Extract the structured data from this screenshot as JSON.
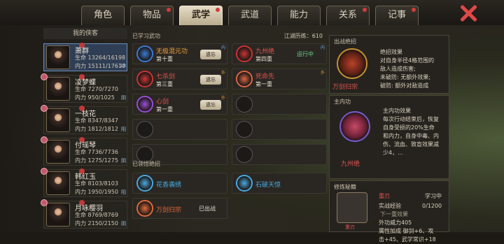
{
  "tabs": [
    {
      "label": "角色",
      "dot": false
    },
    {
      "label": "物品",
      "dot": true
    },
    {
      "label": "武学",
      "dot": true,
      "active": true
    },
    {
      "label": "武道",
      "dot": false
    },
    {
      "label": "能力",
      "dot": false
    },
    {
      "label": "关系",
      "dot": true
    },
    {
      "label": "记事",
      "dot": true
    }
  ],
  "left": {
    "header": "我的侠客",
    "heroes": [
      {
        "name": "萧群",
        "hp": "生命 13264/16198",
        "mp": "内力 15111/17610",
        "lv": "18",
        "selected": true
      },
      {
        "name": "凌梦蝶",
        "hp": "生命 7270/7270",
        "mp": "内力 950/1025",
        "lv": "阴"
      },
      {
        "name": "一枝花",
        "hp": "生命 8347/8347",
        "mp": "内力 1812/1812",
        "lv": "阳"
      },
      {
        "name": "付瑶琴",
        "hp": "生命 7736/7736",
        "mp": "内力 1275/1275",
        "lv": "阴"
      },
      {
        "name": "韩红玉",
        "hp": "生命 8103/8103",
        "mp": "内力 1950/1950",
        "lv": "阳"
      },
      {
        "name": "月咏樱羽",
        "hp": "生命 8769/8769",
        "mp": "内力 2150/2150",
        "lv": "阴"
      }
    ]
  },
  "mid": {
    "learned_title": "已学习武功",
    "points": "江湖历练：610",
    "skills": [
      {
        "name": "无极混元功",
        "level": "第十重",
        "color": "#f0a23a",
        "tag": "内",
        "tagType": "t",
        "btn": "遗忘",
        "iconColor": "#3a7bd5"
      },
      {
        "name": "九州绝",
        "level": "第四重",
        "color": "#e0534e",
        "tag": "内",
        "tagType": "t",
        "status": "运行中",
        "iconColor": "#c33"
      },
      {
        "name": "七杀剑",
        "level": "第三重",
        "color": "#e0534e",
        "tag": "外",
        "tagType": "w",
        "btn": "遗忘",
        "iconColor": "#c33"
      },
      {
        "name": "死命先",
        "level": "第一重",
        "color": "#e0534e",
        "tag": "外",
        "tagType": "w",
        "iconColor": "#d64"
      },
      {
        "name": "心剑",
        "level": "第一重",
        "color": "#e0534e",
        "tag": "外",
        "tagType": "w",
        "btn": "遗忘",
        "iconColor": "#9c4dd6"
      }
    ],
    "ult_title": "已领悟绝招",
    "ults": [
      {
        "name": "花香袭绣",
        "color": "#4aa9e0"
      },
      {
        "name": "石破天惊",
        "color": "#4aa9e0"
      },
      {
        "name": "万剑归宗",
        "color": "#e06a3a",
        "status": "已出战"
      }
    ]
  },
  "right": {
    "ult_panel": "出战绝招",
    "ult_name": "万剑归宗",
    "ult_effect_title": "绝招效果",
    "ult_effect": [
      "对自身半径4格范围的",
      "敌人造成伤害;",
      "未破防: 无额外效果;",
      "破防: 额外对敌造成"
    ],
    "inner_panel": "主内功",
    "inner_name": "九州绝",
    "inner_effect_title": "主内功效果",
    "inner_effect": [
      "每次行动结束后，恢复",
      "自身受损的20%生命",
      "和内力，自身中毒、内",
      "伤、流血、致盲效果减",
      "少4，..."
    ],
    "train_panel": "修炼秘籍",
    "train_name": "重刃",
    "train_state": "学习中",
    "train_exp_label": "实战经验",
    "train_exp": "0/1200",
    "next_label": "下一重效果",
    "next_effect": [
      "外功威力405",
      "属性加成  御剑+6、攻",
      "击+45、武学常识+18"
    ],
    "book_label": "重刃"
  }
}
